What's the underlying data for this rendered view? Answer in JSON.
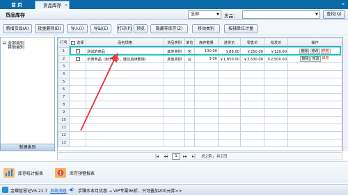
{
  "tabs": {
    "home": "首 页",
    "stock": "货品库存",
    "close": "×",
    "collapse": "«"
  },
  "header": {
    "title": "货品库存",
    "category_select": "全部",
    "goods_label": "货品：",
    "goods_value": "",
    "query_button": "查找(Q)"
  },
  "toolbar": [
    "新增货品(A)",
    "批量删除(D)",
    "导入(I)",
    "导出(E)",
    "打印(P)",
    "预览",
    "隐藏零库存(Z)",
    "移动类别",
    "按辅单位计量"
  ],
  "sidebar": {
    "root": "全部类别",
    "child": "其他类别",
    "new_category_button": "新建类别"
  },
  "table": {
    "headers": [
      "行号",
      "选择",
      "品名规格",
      "货品类别",
      "单位",
      "库存数量",
      "进货价",
      "零售价",
      "批发价",
      "操作"
    ],
    "rows": [
      {
        "n": "1",
        "name": "测试的商品",
        "cat": "其他类别",
        "unit": "包",
        "qty": "100.00",
        "buy": "￥88.00",
        "retail": "￥250.00",
        "wholesale": "￥120.00",
        "ops": [
          "删除",
          "修改",
          "停用"
        ]
      },
      {
        "n": "2",
        "name": "示例商品（用于演示，建议后续删除）",
        "cat": "其他类别",
        "unit": "台",
        "qty": "9.00",
        "buy": "￥1,850.00",
        "retail": "￥3,500.00",
        "wholesale": "￥2,500.00",
        "ops": [
          "删除",
          "修改",
          "启用"
        ]
      }
    ],
    "empty_row_numbers": [
      "3",
      "4",
      "5",
      "6",
      "7",
      "8",
      "9",
      "10",
      "11",
      "12",
      "13"
    ]
  },
  "pager": {
    "first": "|◂",
    "prev": "◂◂",
    "page": "1",
    "next": "▸▸",
    "last": "▸|",
    "summary": "总2条，共1页"
  },
  "reports": [
    "库存统计报表",
    "库存预警报表"
  ],
  "status": {
    "version": "金蝶智慧记V6.21.7",
    "news_label": "系统消息",
    "message": "手赚水本月优惠 → VIP专属96折，只可叠加200元券>>"
  },
  "colors": {
    "tab_bar": "#0b6aa8",
    "highlight": "#18c3c1",
    "red_status": "#d11111"
  }
}
